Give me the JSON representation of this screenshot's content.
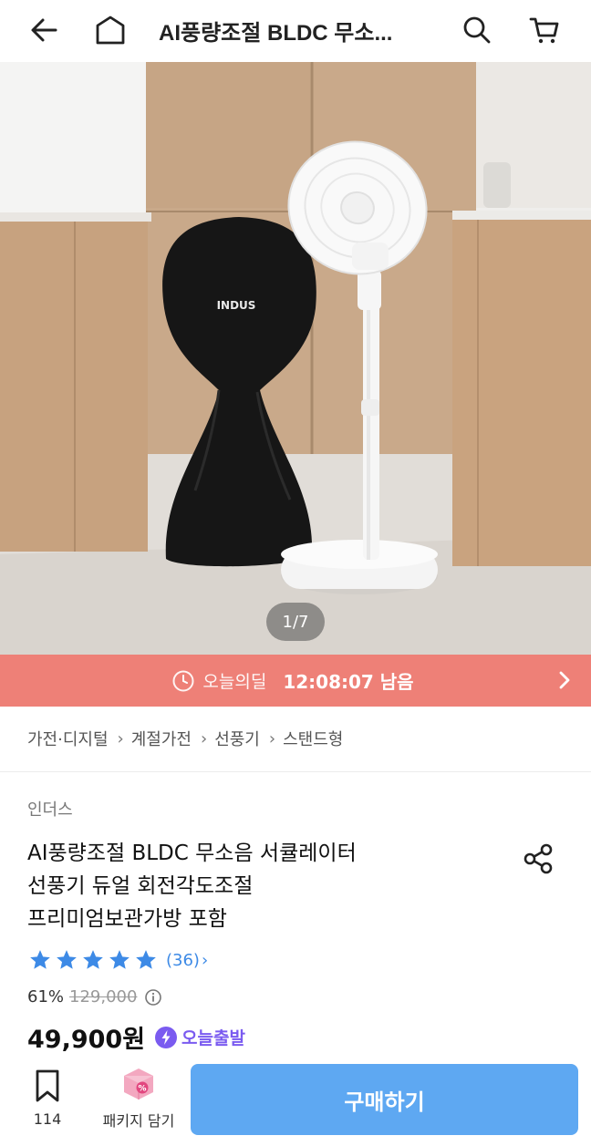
{
  "header": {
    "title": "AI풍량조절 BLDC 무소...",
    "back_icon": "back-arrow-icon",
    "home_icon": "home-icon",
    "search_icon": "search-icon",
    "cart_icon": "cart-icon"
  },
  "hero": {
    "cover_text": "INDUS",
    "counter": "1/7"
  },
  "deal": {
    "label": "오늘의딜",
    "time": "12:08:07 남음",
    "color": "#ee8077"
  },
  "breadcrumb": [
    "가전·디지털",
    "계절가전",
    "선풍기",
    "스탠드형"
  ],
  "product": {
    "brand": "인더스",
    "title_lines": [
      "AI풍량조절 BLDC 무소음 서큘레이터",
      "선풍기 듀얼 회전각도조절",
      "프리미엄보관가방 포함"
    ],
    "rating_stars": 5,
    "review_count": "(36)",
    "discount": "61%",
    "original_price": "129,000",
    "price": "49,900원",
    "shipping_badge": "오늘출발",
    "accent_color": "#3d8ae6"
  },
  "bottom_bar": {
    "bookmark_count": "114",
    "package_label": "패키지 담기",
    "buy_label": "구매하기",
    "buy_color": "#5ea8f2"
  }
}
